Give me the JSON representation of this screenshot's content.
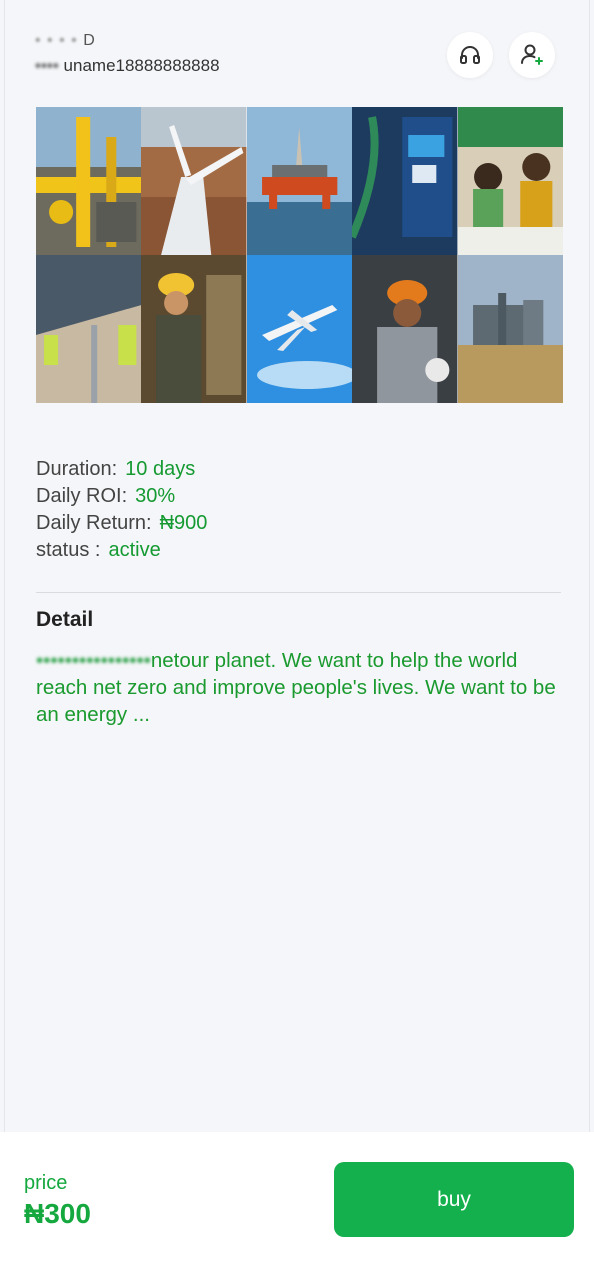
{
  "header": {
    "user_id_prefix": "• • • •",
    "user_id_suffix": "D",
    "user_name_prefix": "••••",
    "user_name": "uname18888888888",
    "icons": [
      "headset-icon",
      "add-user-icon"
    ]
  },
  "gallery": [
    "pipeline-valves-image",
    "wind-turbine-image",
    "offshore-rig-image",
    "ev-charger-image",
    "store-customers-image",
    "solar-workers-image",
    "engineer-image",
    "airplane-image",
    "technician-helmet-image",
    "refinery-field-image"
  ],
  "stats": {
    "duration_label": "Duration:",
    "duration_value": "10 days",
    "roi_label": "Daily ROI:",
    "roi_value": "30%",
    "return_label": "Daily Return:",
    "return_value": "₦900",
    "status_label": "status :",
    "status_value": "active"
  },
  "detail": {
    "title": "Detail",
    "text_blurred": "••••••••••••••••",
    "text": "netour planet. We want to help the world reach net zero and improve people's lives. We want to be an energy ..."
  },
  "footer": {
    "price_label": "price",
    "price_value": "₦300",
    "buy_label": "buy"
  },
  "colors": {
    "accent_green": "#14b04d",
    "text_green": "#1a9a2f",
    "background": "#f5f6f9"
  }
}
